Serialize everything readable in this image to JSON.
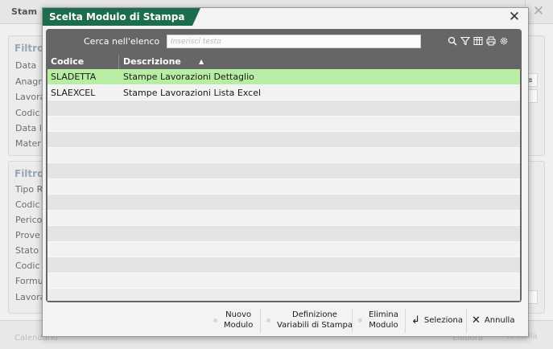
{
  "background": {
    "title": "Stam",
    "panel1_title": "Filtro",
    "panel1_labels": [
      "Data",
      "Anagr",
      "Lavora",
      "Codic",
      "Data l",
      "Mater"
    ],
    "field_value": "≡",
    "panel2_title": "Filtro",
    "panel2_labels": [
      "Tipo R",
      "Codic",
      "Perico",
      "Prove",
      "Stato",
      "Codic",
      "Formu",
      "Lavora"
    ],
    "calendario_label": "Calendario",
    "elabora_label": "Elabora",
    "annulla_label": "Annulla"
  },
  "dialog": {
    "title": "Scelta Modulo di Stampa",
    "search": {
      "label": "Cerca nell'elenco",
      "placeholder": "Inserisci testo"
    },
    "toolbar_icons": [
      "search-icon",
      "filter-icon",
      "columns-icon",
      "print-icon",
      "settings-icon"
    ],
    "columns": {
      "code": "Codice",
      "description": "Descrizione",
      "sort_indicator": "▲"
    },
    "rows": [
      {
        "code": "SLADETTA",
        "description": "Stampe Lavorazioni Dettaglio",
        "selected": true
      },
      {
        "code": "SLAEXCEL",
        "description": "Stampe Lavorazioni Lista Excel",
        "selected": false
      }
    ],
    "empty_rows": 12,
    "buttons": {
      "nuovo_line1": "Nuovo",
      "nuovo_line2": "Modulo",
      "definizione_line1": "Definizione",
      "definizione_line2": "Variabili di Stampa",
      "elimina_line1": "Elimina",
      "elimina_line2": "Modulo",
      "seleziona": "Seleziona",
      "annulla": "Annulla"
    },
    "colors": {
      "title_bg": "#1d6c4e",
      "selected_row": "#b7eea4",
      "panel": "#666666"
    }
  }
}
